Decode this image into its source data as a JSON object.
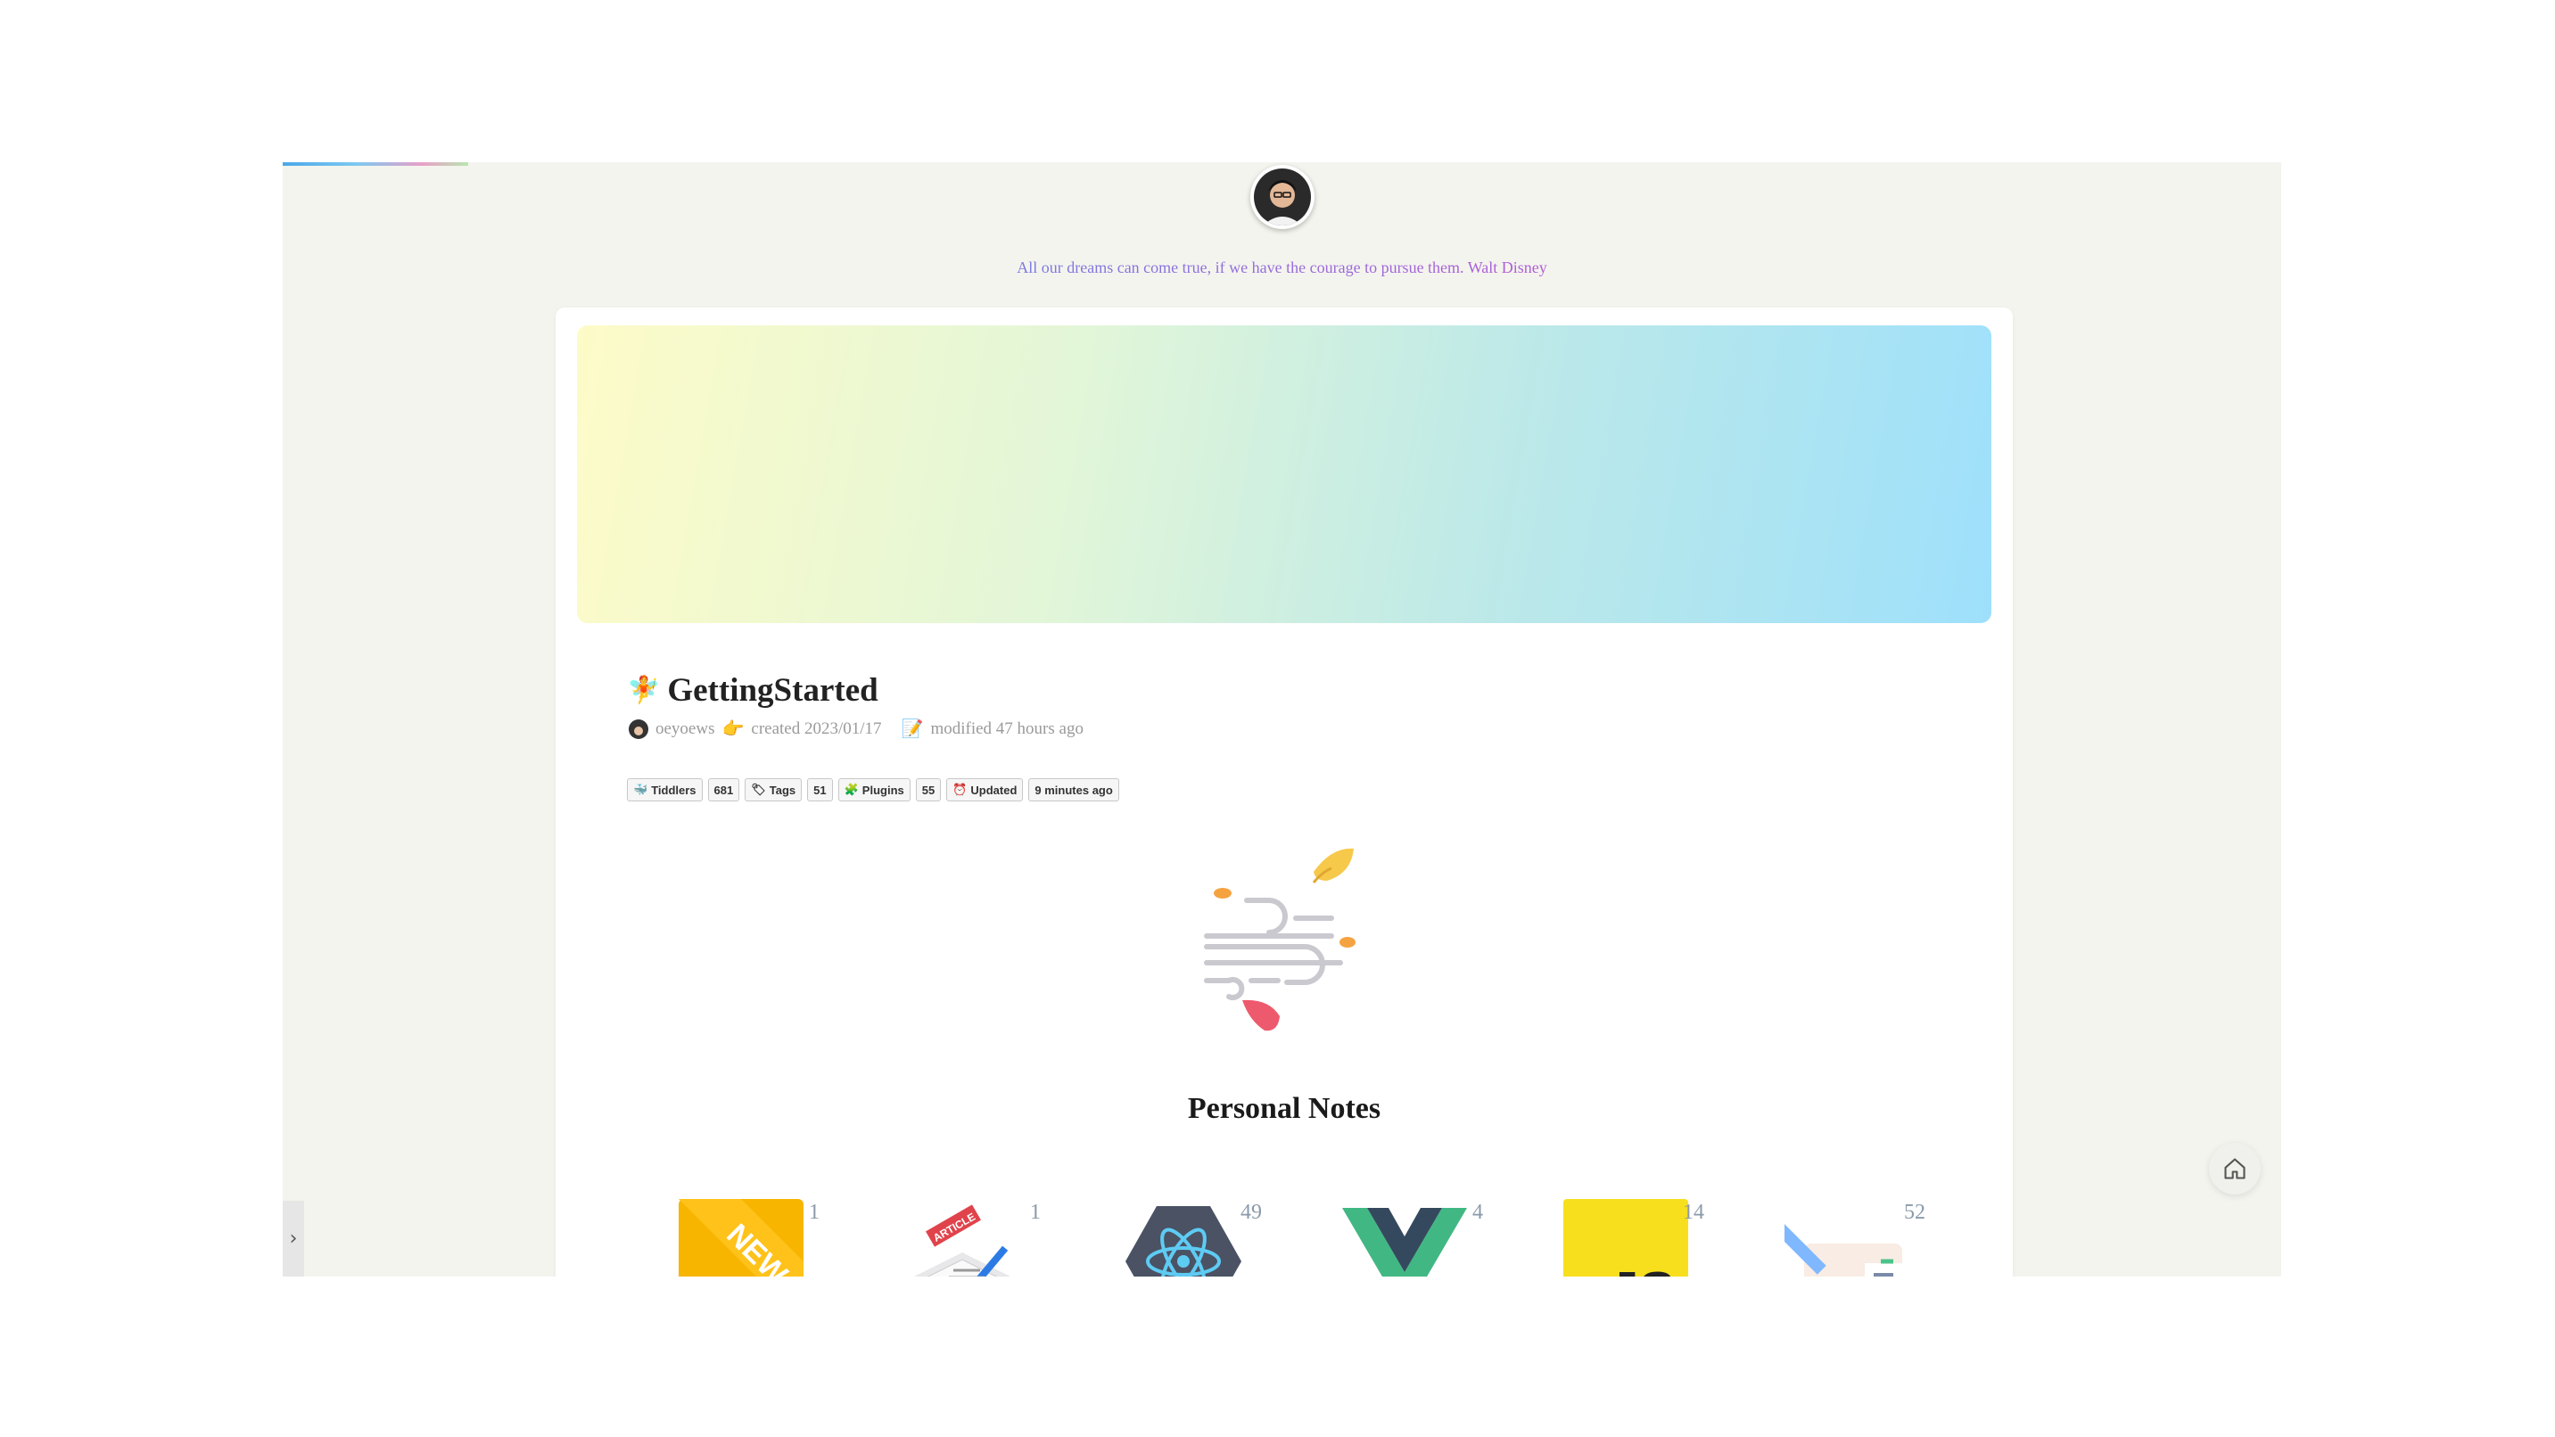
{
  "header": {
    "quote": "All our dreams can come true, if we have the courage to pursue them. Walt Disney"
  },
  "tiddler": {
    "title_icon": "🧚",
    "title": "GettingStarted",
    "author": "oeyoews",
    "created_icon": "👉",
    "created": "created 2023/01/17",
    "modified_icon": "📝",
    "modified": "modified 47 hours ago"
  },
  "badges": [
    {
      "icon": "🐳",
      "label": "Tiddlers",
      "value": "681"
    },
    {
      "icon": "🏷",
      "label": "Tags",
      "value": "51"
    },
    {
      "icon": "🧩",
      "label": "Plugins",
      "value": "55"
    },
    {
      "icon": "⏰",
      "label": "Updated",
      "value": "9 minutes ago"
    }
  ],
  "section": {
    "title": "Personal Notes"
  },
  "tiles": [
    {
      "name": "new",
      "count": "1"
    },
    {
      "name": "article",
      "count": "1"
    },
    {
      "name": "react",
      "count": "49"
    },
    {
      "name": "vue",
      "count": "4"
    },
    {
      "name": "javascript",
      "count": "14"
    },
    {
      "name": "notes",
      "count": "52"
    }
  ],
  "colors": {
    "background": "#f4f4ee",
    "card": "#ffffff",
    "quote_gradient_start": "#7a7ae0",
    "quote_gradient_end": "#b05cd6"
  },
  "icons": {
    "avatar": "user-avatar",
    "hero": "wind-leaves-icon",
    "home": "home-icon",
    "sidebar_toggle": "chevron-right-icon"
  }
}
